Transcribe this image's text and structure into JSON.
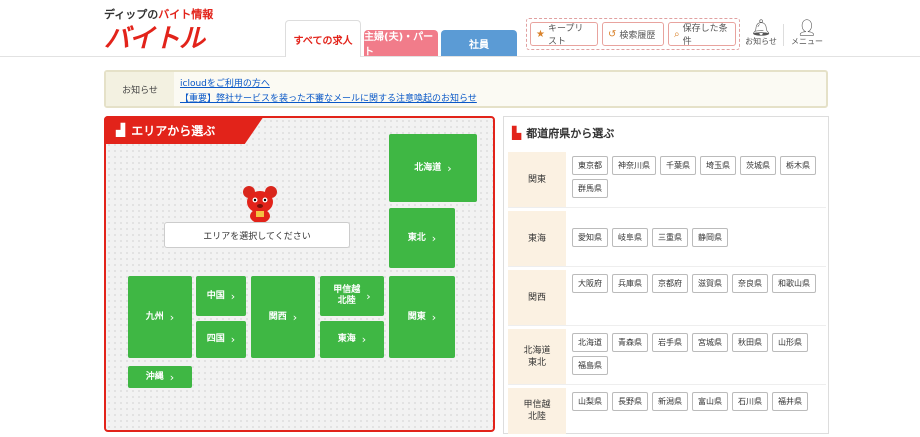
{
  "header": {
    "logo_sub_prefix": "ディップの",
    "logo_sub_accent": "バイト情報",
    "logo_main": "バイトル",
    "tabs": {
      "all": "すべての求人",
      "part": "主婦(夫)・パート",
      "staff": "社員"
    },
    "buttons": {
      "keep": "キープリスト",
      "history": "検索履歴",
      "saved": "保存した条件"
    },
    "notify": "お知らせ",
    "menu": "メニュー"
  },
  "notice": {
    "label": "お知らせ",
    "link1": "icloudをご利用の方へ",
    "link2": "【重要】弊社サービスを装った不審なメールに関する注意喚起のお知らせ"
  },
  "area_panel": {
    "title": "エリアから選ぶ",
    "prompt": "エリアを選択してください",
    "regions": {
      "hokkaido": "北海道",
      "tohoku": "東北",
      "koshinetsu": "甲信越\n北陸",
      "kanto": "関東",
      "chugoku": "中国",
      "kyushu": "九州",
      "kansai": "関西",
      "tokai": "東海",
      "shikoku": "四国",
      "okinawa": "沖縄"
    },
    "chevron": "›"
  },
  "pref_panel": {
    "title": "都道府県から選ぶ",
    "rows": [
      {
        "label": "関東",
        "prefs": [
          "東京都",
          "神奈川県",
          "千葉県",
          "埼玉県",
          "茨城県",
          "栃木県",
          "群馬県"
        ]
      },
      {
        "label": "東海",
        "prefs": [
          "愛知県",
          "岐阜県",
          "三重県",
          "静岡県"
        ]
      },
      {
        "label": "関西",
        "prefs": [
          "大阪府",
          "兵庫県",
          "京都府",
          "滋賀県",
          "奈良県",
          "和歌山県"
        ]
      },
      {
        "label": "北海道\n東北",
        "prefs": [
          "北海道",
          "青森県",
          "岩手県",
          "宮城県",
          "秋田県",
          "山形県",
          "福島県"
        ]
      },
      {
        "label": "甲信越\n北陸",
        "prefs": [
          "山梨県",
          "長野県",
          "新潟県",
          "富山県",
          "石川県",
          "福井県"
        ]
      }
    ]
  },
  "colors": {
    "brand_red": "#e2231a",
    "region_green": "#3fb744",
    "part_tab": "#f17c8a",
    "staff_tab": "#5b9bd5"
  }
}
